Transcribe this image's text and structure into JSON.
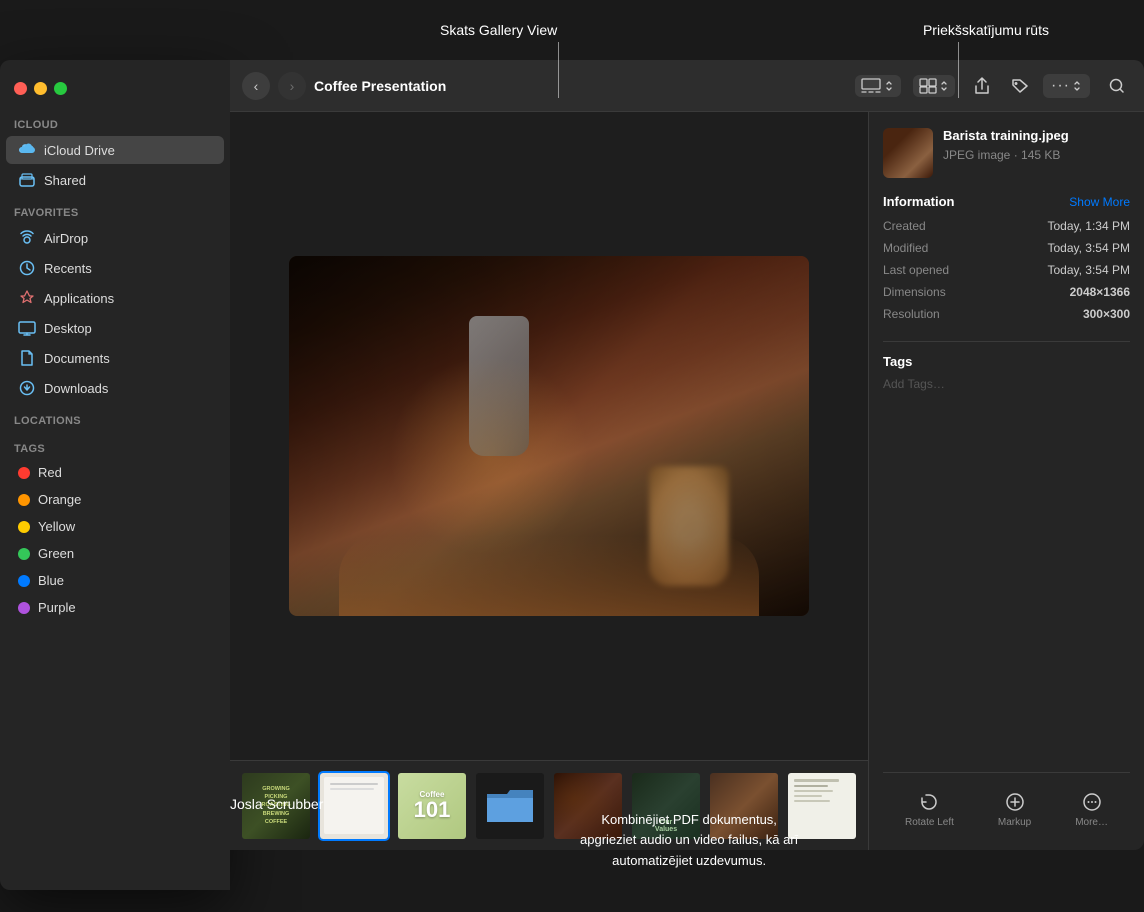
{
  "annotations": {
    "gallery_view_label": "Skats Gallery View",
    "preview_pane_label": "Priekšskatījumu rūts",
    "scrubber_label": "Josla Scrubber",
    "pdf_label": "Kombinējiet PDF dokumentus,\napgrieziet audio un video failus, kā arī\nautomatizējiet uzdevumus."
  },
  "window": {
    "title": "Coffee Presentation",
    "traffic_lights": {
      "red_label": "close",
      "yellow_label": "minimize",
      "green_label": "maximize"
    }
  },
  "sidebar": {
    "icloud_section": "iCloud",
    "icloud_drive_label": "iCloud Drive",
    "shared_label": "Shared",
    "favorites_section": "Favorites",
    "airdrop_label": "AirDrop",
    "recents_label": "Recents",
    "applications_label": "Applications",
    "desktop_label": "Desktop",
    "documents_label": "Documents",
    "downloads_label": "Downloads",
    "locations_section": "Locations",
    "tags_section": "Tags",
    "tags": [
      {
        "name": "Red",
        "color": "#ff3b30"
      },
      {
        "name": "Orange",
        "color": "#ff9500"
      },
      {
        "name": "Yellow",
        "color": "#ffcc00"
      },
      {
        "name": "Green",
        "color": "#34c759"
      },
      {
        "name": "Blue",
        "color": "#007aff"
      },
      {
        "name": "Purple",
        "color": "#af52de"
      }
    ]
  },
  "toolbar": {
    "back_label": "‹",
    "forward_label": "›",
    "view_options": [
      "Gallery View"
    ],
    "show_more_label": "Show More"
  },
  "preview": {
    "filename": "Barista training.jpeg",
    "filetype": "JPEG image · 145 KB",
    "information_label": "Information",
    "show_more": "Show More",
    "created_label": "Created",
    "created_value": "Today, 1:34 PM",
    "modified_label": "Modified",
    "modified_value": "Today, 3:54 PM",
    "last_opened_label": "Last opened",
    "last_opened_value": "Today, 3:54 PM",
    "dimensions_label": "Dimensions",
    "dimensions_value": "2048×1366",
    "resolution_label": "Resolution",
    "resolution_value": "300×300",
    "tags_label": "Tags",
    "add_tags_placeholder": "Add Tags…",
    "rotate_left_label": "Rotate Left",
    "markup_label": "Markup",
    "more_label": "More…"
  },
  "scrubber": {
    "items": [
      {
        "type": "book",
        "label": "GROWING\nPICKING\nROASTING\nBREWING\nCOFFEE"
      },
      {
        "type": "slides",
        "label": "slides",
        "selected": true
      },
      {
        "type": "101",
        "label": "Coffee\n101"
      },
      {
        "type": "folder",
        "label": "folder"
      },
      {
        "type": "coffee-beans",
        "label": "coffee beans"
      },
      {
        "type": "our-values",
        "label": "Our Values"
      },
      {
        "type": "photo",
        "label": "photo"
      },
      {
        "type": "doc",
        "label": "document"
      }
    ]
  }
}
